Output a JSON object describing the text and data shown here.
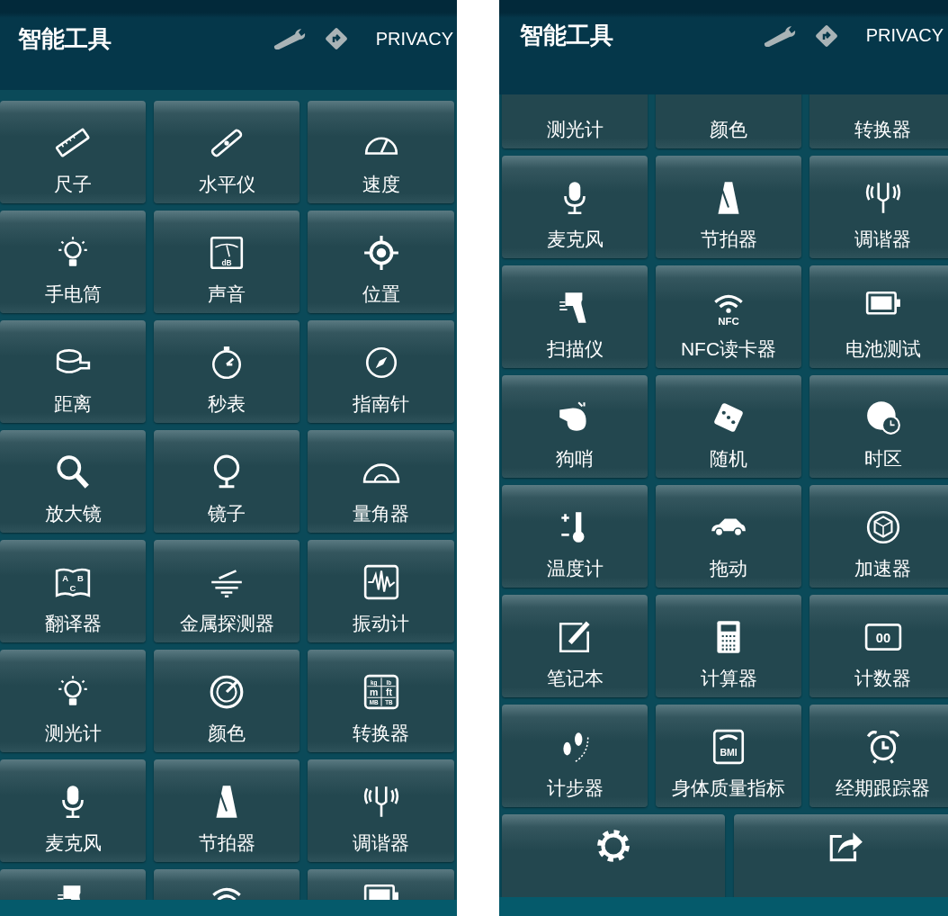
{
  "screens": [
    {
      "title": "智能工具",
      "privacy": "PRIVACY",
      "tiles": [
        {
          "label": "尺子"
        },
        {
          "label": "水平仪"
        },
        {
          "label": "速度"
        },
        {
          "label": "手电筒"
        },
        {
          "label": "声音"
        },
        {
          "label": "位置"
        },
        {
          "label": "距离"
        },
        {
          "label": "秒表"
        },
        {
          "label": "指南针"
        },
        {
          "label": "放大镜"
        },
        {
          "label": "镜子"
        },
        {
          "label": "量角器"
        },
        {
          "label": "翻译器"
        },
        {
          "label": "金属探测器"
        },
        {
          "label": "振动计"
        },
        {
          "label": "测光计"
        },
        {
          "label": "颜色"
        },
        {
          "label": "转换器"
        },
        {
          "label": "麦克风"
        },
        {
          "label": "节拍器"
        },
        {
          "label": "调谐器"
        },
        {
          "cut": true
        },
        {
          "cut": true
        },
        {
          "cut": true
        }
      ],
      "icon_texts": [
        [
          "dB"
        ],
        [
          "A",
          "B",
          "C"
        ],
        [
          "kg",
          "lb",
          "m",
          "ft",
          "MB",
          "TB"
        ]
      ]
    },
    {
      "title": "智能工具",
      "privacy": "PRIVACY",
      "tiles": [
        {
          "label": "测光计"
        },
        {
          "label": "颜色"
        },
        {
          "label": "转换器"
        },
        {
          "label": "麦克风"
        },
        {
          "label": "节拍器"
        },
        {
          "label": "调谐器"
        },
        {
          "label": "扫描仪"
        },
        {
          "label": "NFC读卡器"
        },
        {
          "label": "电池测试"
        },
        {
          "label": "狗哨"
        },
        {
          "label": "随机"
        },
        {
          "label": "时区"
        },
        {
          "label": "温度计"
        },
        {
          "label": "拖动"
        },
        {
          "label": "加速器"
        },
        {
          "label": "笔记本"
        },
        {
          "label": "计算器"
        },
        {
          "label": "计数器"
        },
        {
          "label": "计步器"
        },
        {
          "label": "身体质量指标"
        },
        {
          "label": "经期跟踪器"
        }
      ],
      "icon_texts": [
        [
          "NFC"
        ],
        [
          "00"
        ],
        [
          "BMI"
        ]
      ],
      "footer_tiles": [
        {
          "cut": true
        },
        {
          "cut": true
        }
      ]
    }
  ]
}
